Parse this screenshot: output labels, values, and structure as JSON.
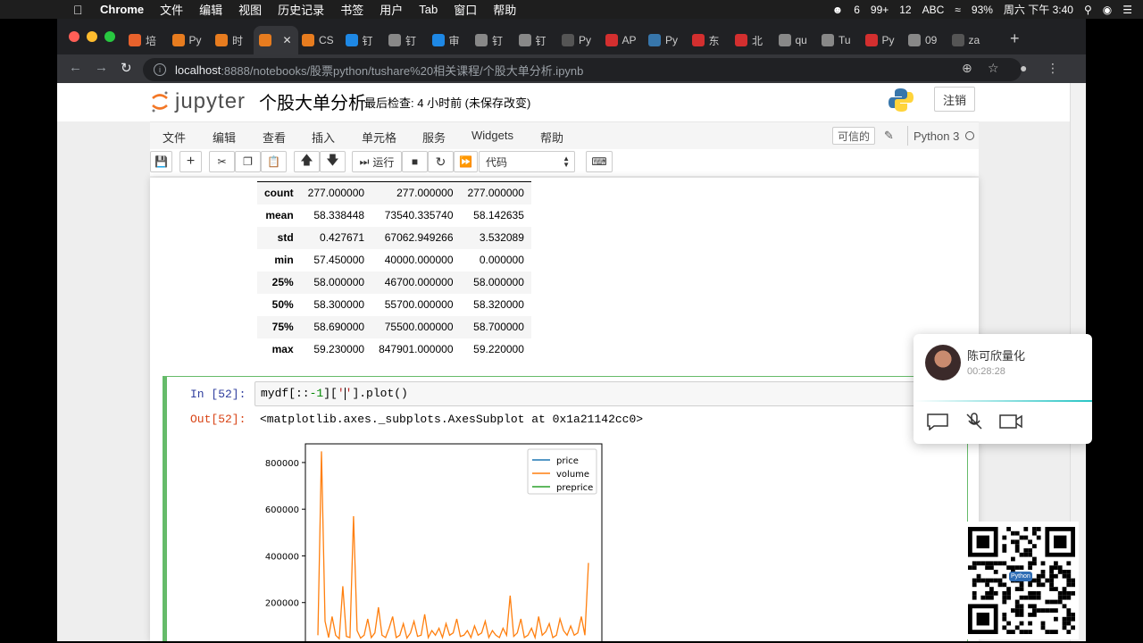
{
  "menubar": {
    "app": "Chrome",
    "items": [
      "文件",
      "编辑",
      "视图",
      "历史记录",
      "书签",
      "用户",
      "Tab",
      "窗口",
      "帮助"
    ],
    "status": {
      "wechat_count": "6",
      "mail_count": "99+",
      "notif_count": "12",
      "input_method": "ABC",
      "battery": "93%",
      "clock": "周六 下午 3:40"
    }
  },
  "browser": {
    "tabs": [
      {
        "label": "培",
        "color": "#e8622c"
      },
      {
        "label": "Py",
        "color": "#e77c1f"
      },
      {
        "label": "时",
        "color": "#e77c1f"
      },
      {
        "label": "",
        "color": "#e77c1f",
        "active": true
      },
      {
        "label": "CS",
        "color": "#e77c1f"
      },
      {
        "label": "钉",
        "color": "#1e88e5"
      },
      {
        "label": "钉",
        "color": "#888888"
      },
      {
        "label": "审",
        "color": "#1e88e5"
      },
      {
        "label": "钉",
        "color": "#888888"
      },
      {
        "label": "钉",
        "color": "#888888"
      },
      {
        "label": "Py",
        "color": "#555555"
      },
      {
        "label": "AP",
        "color": "#d32f2f"
      },
      {
        "label": "Py",
        "color": "#3776ab"
      },
      {
        "label": "东",
        "color": "#d32f2f"
      },
      {
        "label": "北",
        "color": "#d32f2f"
      },
      {
        "label": "qu",
        "color": "#888888"
      },
      {
        "label": "Tu",
        "color": "#888888"
      },
      {
        "label": "Py",
        "color": "#d32f2f"
      },
      {
        "label": "09",
        "color": "#888888"
      },
      {
        "label": "za",
        "color": "#555555"
      }
    ],
    "url_host": "localhost",
    "url_path": ":8888/notebooks/股票python/tushare%20相关课程/个股大单分析.ipynb"
  },
  "jupyter": {
    "logo_text": "jupyter",
    "notebook_title": "个股大单分析",
    "checkpoint": "最后检查: 4 小时前   (未保存改变)",
    "logout_label": "注销",
    "menu": [
      "文件",
      "编辑",
      "查看",
      "插入",
      "单元格",
      "服务",
      "Widgets",
      "帮助"
    ],
    "trusted_label": "可信的",
    "kernel_name": "Python 3",
    "run_label": "运行",
    "cell_type": "代码"
  },
  "describe_table": {
    "rows": [
      {
        "label": "count",
        "values": [
          "277.000000",
          "277.000000",
          "277.000000"
        ]
      },
      {
        "label": "mean",
        "values": [
          "58.338448",
          "73540.335740",
          "58.142635"
        ]
      },
      {
        "label": "std",
        "values": [
          "0.427671",
          "67062.949266",
          "3.532089"
        ]
      },
      {
        "label": "min",
        "values": [
          "57.450000",
          "40000.000000",
          "0.000000"
        ]
      },
      {
        "label": "25%",
        "values": [
          "58.000000",
          "46700.000000",
          "58.000000"
        ]
      },
      {
        "label": "50%",
        "values": [
          "58.300000",
          "55700.000000",
          "58.320000"
        ]
      },
      {
        "label": "75%",
        "values": [
          "58.690000",
          "75500.000000",
          "58.700000"
        ]
      },
      {
        "label": "max",
        "values": [
          "59.230000",
          "847901.000000",
          "59.220000"
        ]
      }
    ]
  },
  "cell": {
    "in_prompt": "In [52]:",
    "code_a": "mydf[::",
    "code_num": "-1",
    "code_b": "][",
    "code_str1": "'",
    "code_str2": "'",
    "code_c": "].plot()",
    "out_prompt": "Out[52]:",
    "out_text": "<matplotlib.axes._subplots.AxesSubplot at 0x1a21142cc0>"
  },
  "chart_data": {
    "type": "line",
    "yticks": [
      200000,
      400000,
      600000,
      800000
    ],
    "ytick_labels": [
      "200000",
      "400000",
      "600000",
      "800000"
    ],
    "ylim": [
      0,
      880000
    ],
    "series": [
      {
        "name": "price",
        "color": "#1f77b4",
        "values": [
          58,
          58,
          58,
          58,
          58
        ]
      },
      {
        "name": "volume",
        "color": "#ff7f0e",
        "values": [
          60000,
          847901,
          120000,
          50000,
          140000,
          60000,
          45000,
          270000,
          55000,
          50000,
          570000,
          80000,
          48000,
          60000,
          130000,
          50000,
          70000,
          180000,
          60000,
          50000,
          90000,
          140000,
          50000,
          60000,
          110000,
          48000,
          70000,
          120000,
          55000,
          60000,
          150000,
          50000,
          80000,
          60000,
          90000,
          50000,
          110000,
          60000,
          70000,
          130000,
          55000,
          60000,
          80000,
          50000,
          100000,
          60000,
          70000,
          120000,
          50000,
          80000,
          60000,
          50000,
          90000,
          60000,
          230000,
          55000,
          70000,
          130000,
          50000,
          60000,
          90000,
          50000,
          140000,
          60000,
          75000,
          110000,
          50000,
          60000,
          130000,
          80000,
          60000,
          100000,
          60000,
          70000,
          140000,
          60000,
          370000
        ]
      },
      {
        "name": "preprice",
        "color": "#2ca02c",
        "values": [
          58,
          58,
          58,
          58,
          58
        ]
      }
    ],
    "legend": "top-right"
  },
  "call_widget": {
    "name": "陈可欣量化",
    "timer": "00:28:28"
  },
  "qr_label": "Python"
}
